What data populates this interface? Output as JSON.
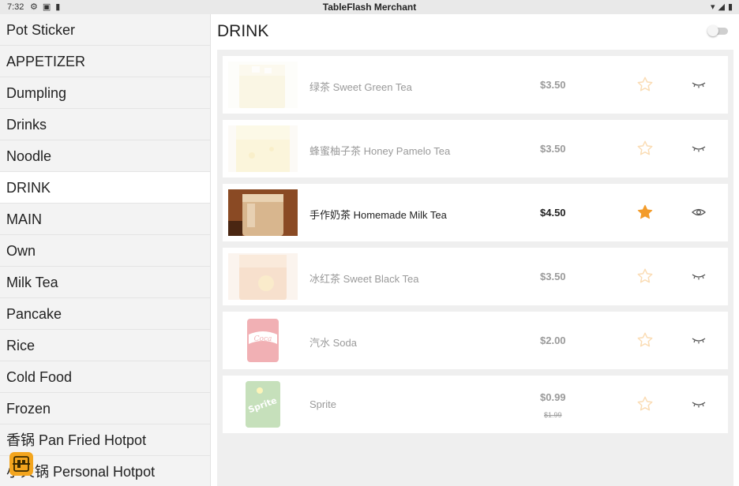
{
  "status_bar": {
    "time": "7:32",
    "app_title": "TableFlash Merchant"
  },
  "sidebar": {
    "categories": [
      {
        "label": "Pot Sticker",
        "active": false
      },
      {
        "label": "APPETIZER",
        "active": false
      },
      {
        "label": "Dumpling",
        "active": false
      },
      {
        "label": "Drinks",
        "active": false
      },
      {
        "label": "Noodle",
        "active": false
      },
      {
        "label": "DRINK",
        "active": true
      },
      {
        "label": "MAIN",
        "active": false
      },
      {
        "label": "Own",
        "active": false
      },
      {
        "label": "Milk Tea",
        "active": false
      },
      {
        "label": "Pancake",
        "active": false
      },
      {
        "label": "Rice",
        "active": false
      },
      {
        "label": "Cold Food",
        "active": false
      },
      {
        "label": "Frozen",
        "active": false
      },
      {
        "label": "香锅 Pan Fried Hotpot",
        "active": false
      },
      {
        "label": "小火锅 Personal Hotpot",
        "active": false
      }
    ]
  },
  "main": {
    "title": "DRINK",
    "toggle_on": false,
    "items": [
      {
        "name": "绿茶 Sweet Green Tea",
        "price": "$3.50",
        "original_price": "",
        "enabled": false,
        "favorite": false,
        "visible": false,
        "image": "green-tea-image"
      },
      {
        "name": "蜂蜜柚子茶 Honey Pamelo Tea",
        "price": "$3.50",
        "original_price": "",
        "enabled": false,
        "favorite": false,
        "visible": false,
        "image": "honey-pomelo-tea-image"
      },
      {
        "name": "手作奶茶 Homemade Milk Tea",
        "price": "$4.50",
        "original_price": "",
        "enabled": true,
        "favorite": true,
        "visible": true,
        "image": "milk-tea-image"
      },
      {
        "name": "冰红茶 Sweet Black Tea",
        "price": "$3.50",
        "original_price": "",
        "enabled": false,
        "favorite": false,
        "visible": false,
        "image": "black-tea-image"
      },
      {
        "name": "汽水 Soda",
        "price": "$2.00",
        "original_price": "",
        "enabled": false,
        "favorite": false,
        "visible": false,
        "image": "soda-can-image"
      },
      {
        "name": "Sprite",
        "price": "$0.99",
        "original_price": "$1.99",
        "enabled": false,
        "favorite": false,
        "visible": false,
        "image": "sprite-can-image"
      }
    ]
  },
  "colors": {
    "accent": "#f39c2b",
    "fab": "#f3a51e",
    "sidebar_bg": "#f3f3f3",
    "list_bg": "#efefef"
  }
}
